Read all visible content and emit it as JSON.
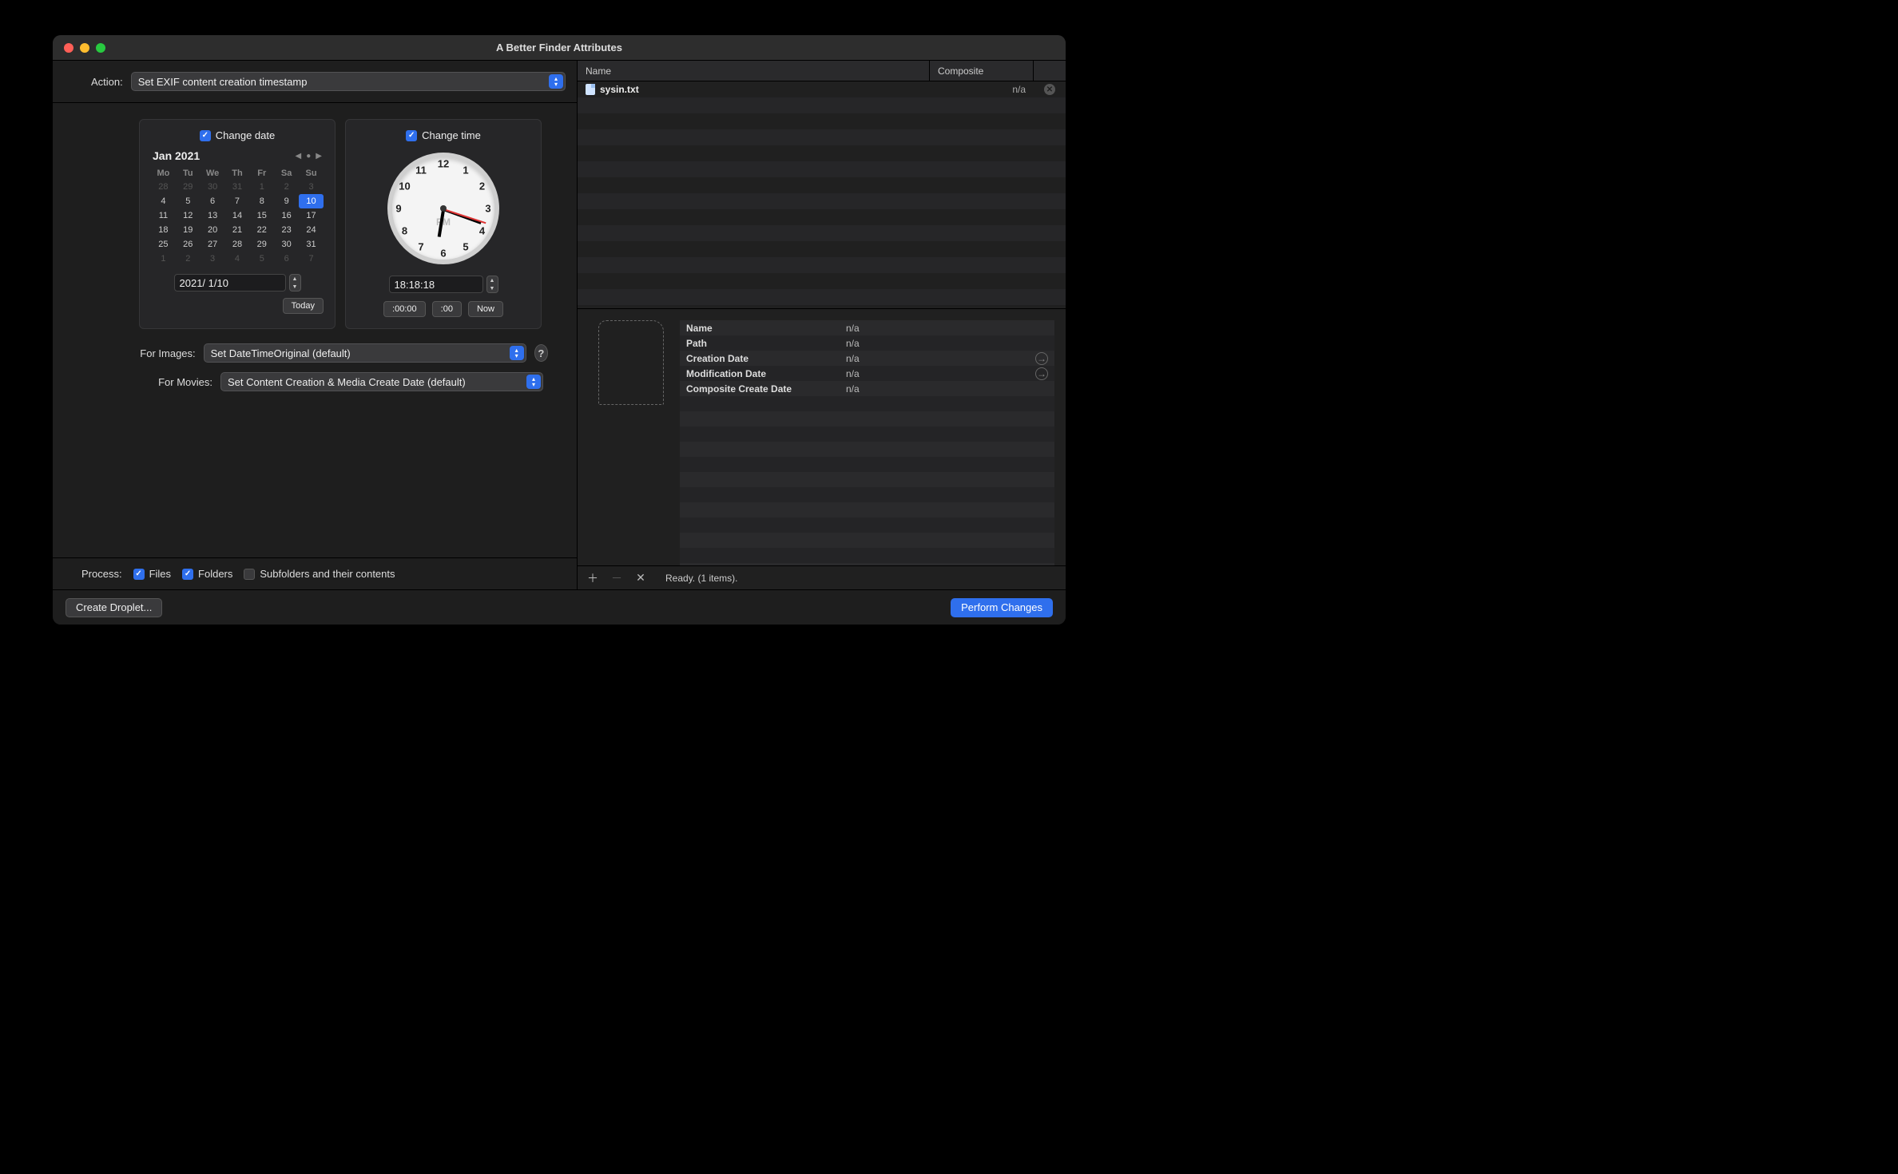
{
  "window": {
    "title": "A Better Finder Attributes"
  },
  "action": {
    "label": "Action:",
    "value": "Set EXIF content creation timestamp"
  },
  "date_panel": {
    "checkbox": "Change date",
    "month_title": "Jan 2021",
    "weekdays": [
      "Mo",
      "Tu",
      "We",
      "Th",
      "Fr",
      "Sa",
      "Su"
    ],
    "grid": [
      [
        "28",
        "29",
        "30",
        "31",
        "1",
        "2",
        "3"
      ],
      [
        "4",
        "5",
        "6",
        "7",
        "8",
        "9",
        "10"
      ],
      [
        "11",
        "12",
        "13",
        "14",
        "15",
        "16",
        "17"
      ],
      [
        "18",
        "19",
        "20",
        "21",
        "22",
        "23",
        "24"
      ],
      [
        "25",
        "26",
        "27",
        "28",
        "29",
        "30",
        "31"
      ],
      [
        "1",
        "2",
        "3",
        "4",
        "5",
        "6",
        "7"
      ]
    ],
    "dim_rows": [
      0,
      5
    ],
    "selected": [
      1,
      6
    ],
    "date_field": "2021/  1/10",
    "today_btn": "Today"
  },
  "time_panel": {
    "checkbox": "Change time",
    "ampm": "PM",
    "time_field": "18:18:18",
    "btn_zero_all": ":00:00",
    "btn_zero_sec": ":00",
    "btn_now": "Now",
    "clock_numbers": [
      "12",
      "1",
      "2",
      "3",
      "4",
      "5",
      "6",
      "7",
      "8",
      "9",
      "10",
      "11"
    ]
  },
  "images_row": {
    "label": "For Images:",
    "value": "Set DateTimeOriginal (default)"
  },
  "movies_row": {
    "label": "For Movies:",
    "value": "Set Content Creation & Media Create Date (default)"
  },
  "process": {
    "label": "Process:",
    "files": "Files",
    "folders": "Folders",
    "subfolders": "Subfolders and their contents"
  },
  "footer": {
    "create_droplet": "Create Droplet...",
    "perform": "Perform Changes"
  },
  "table": {
    "col_name": "Name",
    "col_composite": "Composite",
    "rows": [
      {
        "name": "sysin.txt",
        "composite": "n/a"
      }
    ]
  },
  "details": {
    "rows": [
      {
        "k": "Name",
        "v": "n/a",
        "go": false
      },
      {
        "k": "Path",
        "v": "n/a",
        "go": false
      },
      {
        "k": "Creation Date",
        "v": "n/a",
        "go": true
      },
      {
        "k": "Modification Date",
        "v": "n/a",
        "go": true
      },
      {
        "k": "Composite Create Date",
        "v": "n/a",
        "go": false
      }
    ]
  },
  "toolbar": {
    "status": "Ready. (1 items)."
  }
}
